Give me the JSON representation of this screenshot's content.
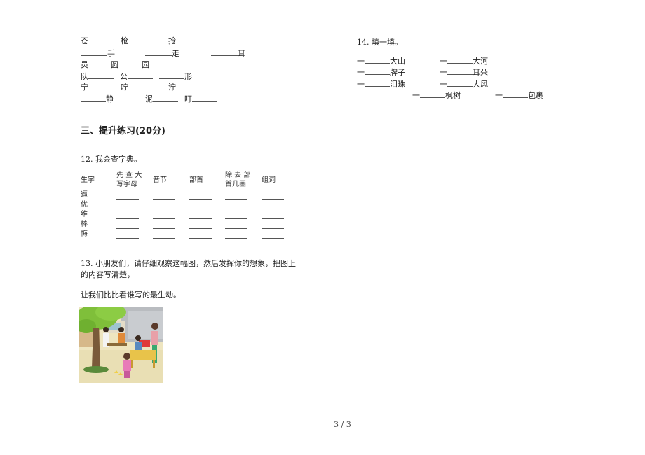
{
  "section_left_top": {
    "rows": [
      [
        "苍",
        "枪",
        "抢"
      ],
      [
        "手",
        "走",
        "耳"
      ],
      [
        "员",
        "圆",
        "园"
      ],
      [
        "队",
        "公",
        "形"
      ],
      [
        "宁",
        "咛",
        "泞"
      ],
      [
        "静",
        "泥",
        "叮"
      ]
    ]
  },
  "section3": {
    "heading": "三、提升练习(20分)"
  },
  "q12": {
    "title": "12. 我会查字典。",
    "headers": [
      "生字",
      "先 查 大\n写字母",
      "音节",
      "部首",
      "除 去 部\n首几画",
      "组词"
    ],
    "header_lines": {
      "h0": "生字",
      "h1a": "先 查 大",
      "h1b": "写字母",
      "h2": "音节",
      "h3": "部首",
      "h4a": "除 去 部",
      "h4b": "首几画",
      "h5": "组词"
    },
    "chars": [
      "逼",
      "优",
      "维",
      "棒",
      "悔"
    ]
  },
  "q13": {
    "line1": "13. 小朋友们，请仔细观察这幅图，然后发挥你的想象，把图上",
    "line2": "的内容写清楚，",
    "line3": "让我们比比看谁写的最生动。",
    "image_alt": "illustration-courtyard-scene"
  },
  "q14": {
    "title": "14. 填一填。",
    "prefix": "一",
    "items": [
      "大山",
      "大河",
      "牌子",
      "耳朵",
      "泪珠",
      "大风",
      "枫树",
      "包裹"
    ]
  },
  "footer": {
    "page": "3 / 3"
  }
}
